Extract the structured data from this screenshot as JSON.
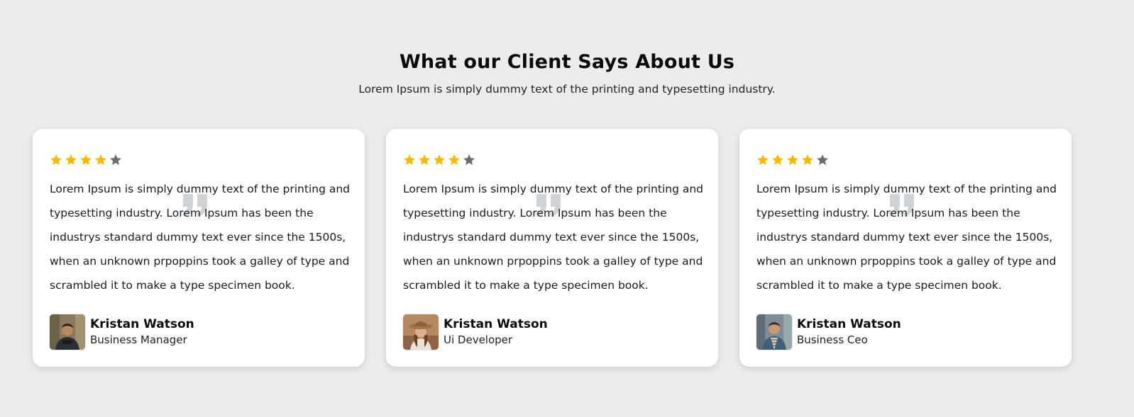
{
  "section": {
    "title": "What our Client Says About Us",
    "subtitle": "Lorem Ipsum is simply dummy text of the printing and typesetting industry."
  },
  "colors": {
    "background": "#ececec",
    "card": "#ffffff",
    "star_filled": "#f6b900",
    "star_empty": "#6b6b6b",
    "quote_mark": "#cfd3d6"
  },
  "icons": {
    "rating": "star-icon",
    "quote": "quote-icon"
  },
  "testimonials": [
    {
      "rating": 4,
      "max_rating": 5,
      "text": "Lorem Ipsum is simply dummy text of the printing and typesetting industry. Lorem Ipsum has been the industrys standard dummy text ever since the 1500s, when an unknown prpoppins took a galley of type and scrambled it to make a type specimen book.",
      "name": "Kristan Watson",
      "role": "Business Manager"
    },
    {
      "rating": 4,
      "max_rating": 5,
      "text": "Lorem Ipsum is simply dummy text of the printing and typesetting industry. Lorem Ipsum has been the industrys standard dummy text ever since the 1500s, when an unknown prpoppins took a galley of type and scrambled it to make a type specimen book.",
      "name": "Kristan Watson",
      "role": "Ui Developer"
    },
    {
      "rating": 4,
      "max_rating": 5,
      "text": "Lorem Ipsum is simply dummy text of the printing and typesetting industry. Lorem Ipsum has been the industrys standard dummy text ever since the 1500s, when an unknown prpoppins took a galley of type and scrambled it to make a type specimen book.",
      "name": "Kristan Watson",
      "role": "Business Ceo"
    }
  ]
}
